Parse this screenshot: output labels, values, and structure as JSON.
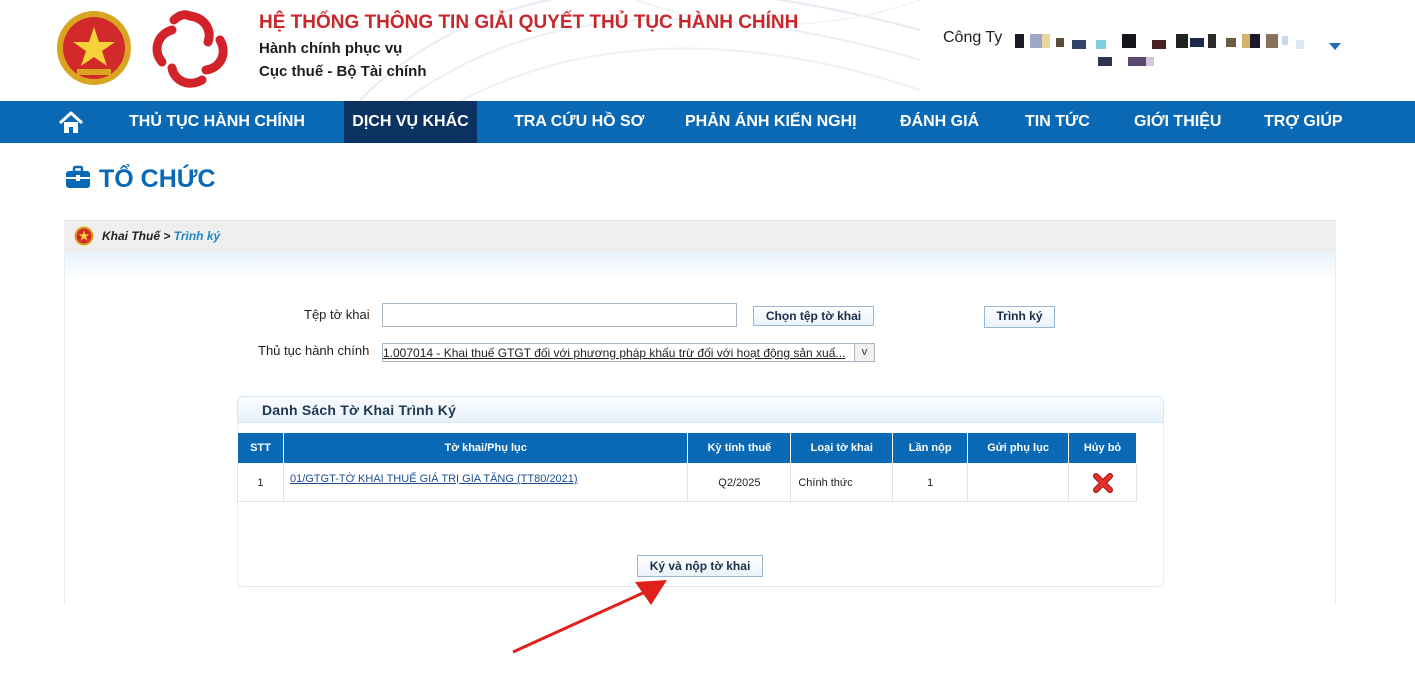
{
  "header": {
    "system_title": "HỆ THỐNG THÔNG TIN GIẢI QUYẾT THỦ TỤC HÀNH CHÍNH",
    "subtitle_1": "Hành chính phục vụ",
    "subtitle_2": "Cục thuế - Bộ Tài chính",
    "company_label": "Công Ty",
    "emblem_icon": "national-emblem-icon",
    "logo_icon": "public-service-logo-icon",
    "user_menu_icon": "caret-down-icon"
  },
  "nav": {
    "home_icon": "home-icon",
    "items": [
      {
        "label": "THỦ TỤC HÀNH CHÍNH",
        "active": false
      },
      {
        "label": "DỊCH VỤ KHÁC",
        "active": true
      },
      {
        "label": "TRA CỨU HỒ SƠ",
        "active": false
      },
      {
        "label": "PHẢN ÁNH KIẾN NGHỊ",
        "active": false
      },
      {
        "label": "ĐÁNH GIÁ",
        "active": false
      },
      {
        "label": "TIN TỨC",
        "active": false
      },
      {
        "label": "GIỚI THIỆU",
        "active": false
      },
      {
        "label": "TRỢ GIÚP",
        "active": false
      }
    ]
  },
  "page": {
    "title": "TỔ CHỨC",
    "title_icon": "briefcase-icon"
  },
  "breadcrumb": {
    "parent": "Khai Thuế",
    "separator": ">",
    "current": "Trình ký"
  },
  "form": {
    "file_label": "Tệp tờ khai",
    "file_value": "",
    "choose_file_button": "Chọn tệp tờ khai",
    "submit_sign_button": "Trình ký",
    "procedure_label": "Thủ tục hành chính",
    "procedure_selected": "1.007014 - Khai thuế GTGT đối với phương pháp khấu trừ đối với hoạt động sản xuấ...",
    "dropdown_arrow": "v"
  },
  "list": {
    "title": "Danh Sách Tờ Khai Trình Ký",
    "columns": [
      "STT",
      "Tờ khai/Phụ lục",
      "Kỳ tính thuế",
      "Loại tờ khai",
      "Lần nộp",
      "Gửi phụ lục",
      "Hủy bỏ"
    ],
    "rows": [
      {
        "stt": "1",
        "name": "01/GTGT-TỜ KHAI THUẾ GIÁ TRỊ GIA TĂNG (TT80/2021)",
        "period": "Q2/2025",
        "type": "Chính thức",
        "attempt": "1",
        "appendix": "",
        "cancel_icon": "delete-x-icon"
      }
    ]
  },
  "actions": {
    "sign_and_submit": "Ký và nộp tờ khai"
  },
  "colors": {
    "nav_blue": "#0a69b5",
    "nav_active": "#0b3260",
    "title_red": "#c8282c",
    "annotation_arrow": "#e0201c"
  }
}
